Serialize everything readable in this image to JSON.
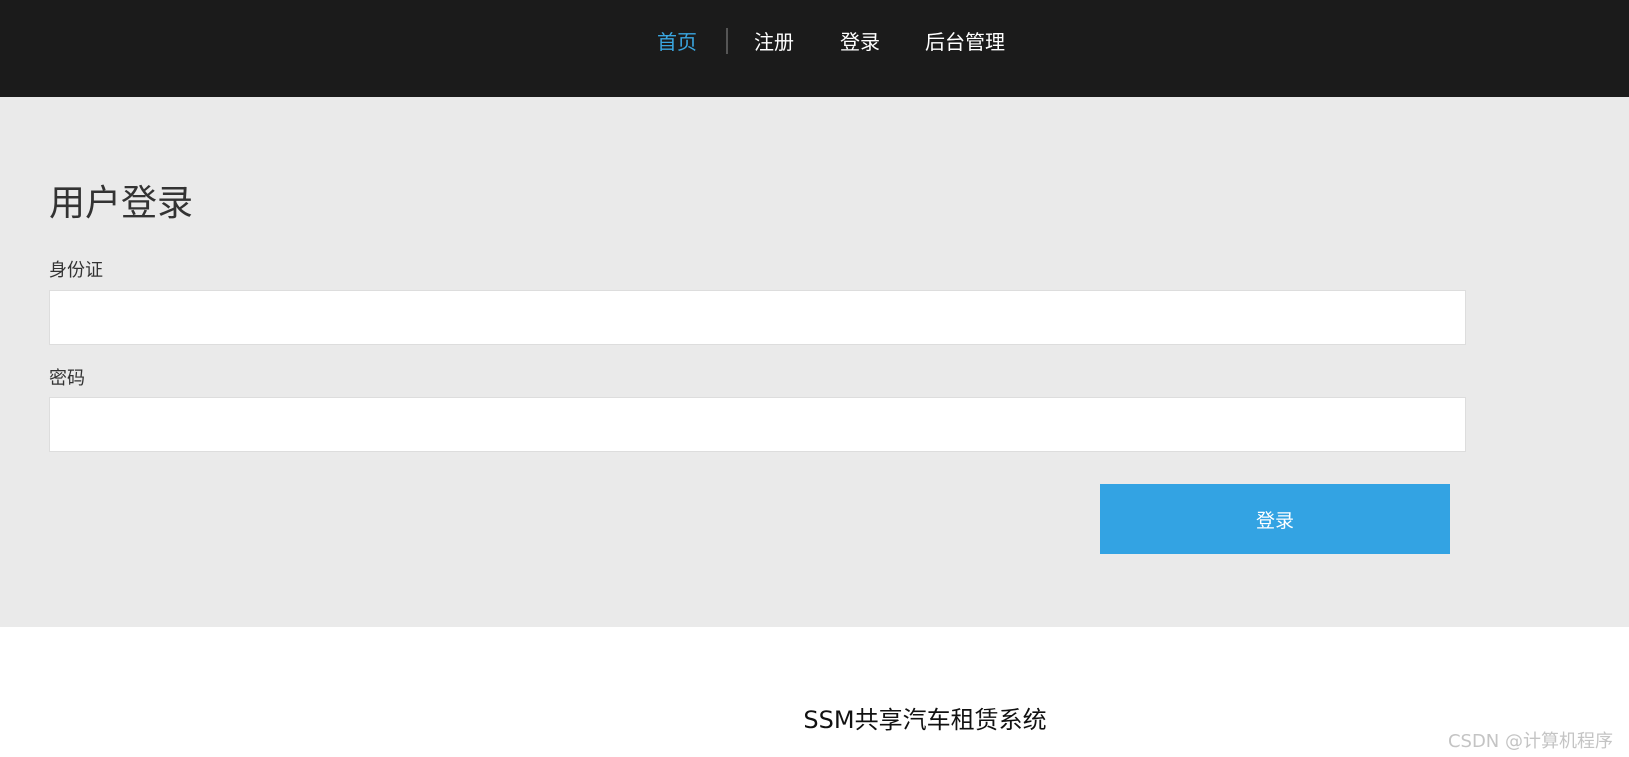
{
  "nav": {
    "items": [
      {
        "label": "首页",
        "active": true
      },
      {
        "label": "注册",
        "active": false
      },
      {
        "label": "登录",
        "active": false
      },
      {
        "label": "后台管理",
        "active": false
      }
    ]
  },
  "login": {
    "title": "用户登录",
    "id_label": "身份证",
    "id_value": "",
    "password_label": "密码",
    "password_value": "",
    "submit_label": "登录"
  },
  "footer": {
    "system_name": "SSM共享汽车租赁系统"
  },
  "watermark": "CSDN @计算机程序",
  "colors": {
    "header_bg": "#1b1b1b",
    "active_link": "#3aa6e0",
    "section_bg": "#eaeaea",
    "button_bg": "#33a3e3"
  }
}
